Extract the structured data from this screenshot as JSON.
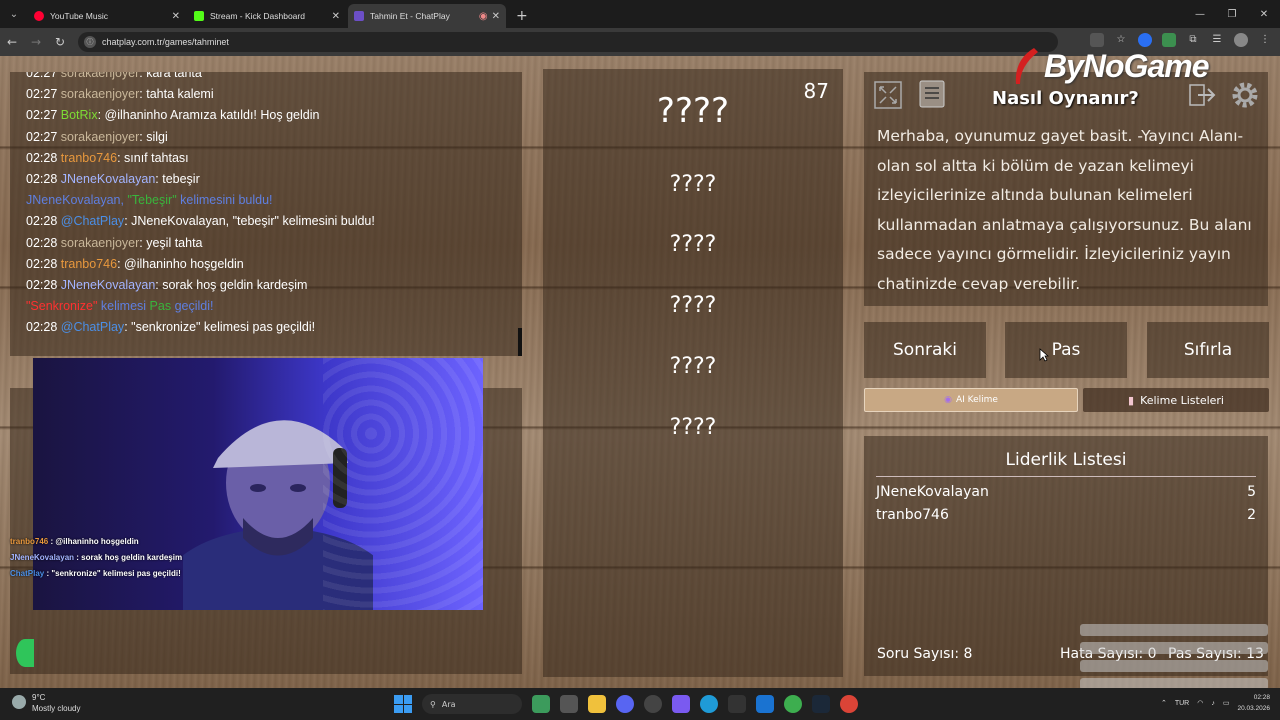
{
  "browser": {
    "tabs": [
      {
        "title": "YouTube Music",
        "color": "#ff0033"
      },
      {
        "title": "Stream - Kick Dashboard",
        "color": "#53fc18"
      },
      {
        "title": "Tahmin Et - ChatPlay",
        "color": "#6c4fc7"
      }
    ],
    "url": "chatplay.com.tr/games/tahminet"
  },
  "chat": {
    "messages": [
      {
        "time": "02:27",
        "user": "sorakaenjoyer",
        "text": ": kara tahta"
      },
      {
        "time": "02:27",
        "user": "sorakaenjoyer",
        "text": ": tahta kalemi"
      },
      {
        "time": "02:27",
        "user": "BotRix",
        "text": ": @ilhaninho Aramıza katıldı! Hoş geldin"
      },
      {
        "time": "02:27",
        "user": "sorakaenjoyer",
        "text": ": silgi"
      },
      {
        "time": "02:28",
        "user": "tranbo746",
        "text": ": sınıf tahtası"
      },
      {
        "time": "02:28",
        "user": "JNeneKovalayan",
        "text": ": tebeşir"
      },
      {
        "system1_user": "JNeneKovalayan,",
        "system1_word": "\"Tebeşir\"",
        "system1_text": "kelimesini buldu!"
      },
      {
        "time": "02:28",
        "user": "@ChatPlay",
        "text": ": JNeneKovalayan, \"tebeşir\" kelimesini buldu!"
      },
      {
        "time": "02:28",
        "user": "sorakaenjoyer",
        "text": ": yeşil tahta"
      },
      {
        "time": "02:28",
        "user": "tranbo746",
        "text": ": @ilhaninho hoşgeldin"
      },
      {
        "time": "02:28",
        "user": "JNeneKovalayan",
        "text": ": sorak hoş geldin kardeşim"
      },
      {
        "system2_word": "\"Senkronize\"",
        "system2_kel": "kelimesi",
        "system2_pas": "Pas",
        "system2_text": "geçildi!"
      },
      {
        "time": "02:28",
        "user": "@ChatPlay",
        "text": ": \"senkronize\" kelimesi pas geçildi!"
      }
    ]
  },
  "cam_chat": [
    {
      "user": "tranbo746",
      "text": " : @ilhaninho hoşgeldin"
    },
    {
      "user": "JNeneKovalayan",
      "text": " : sorak hoş geldin kardeşim"
    },
    {
      "user": "ChatPlay",
      "text": " : \"senkronize\" kelimesi pas geçildi!"
    }
  ],
  "game": {
    "counter": "87",
    "main_word": "????",
    "hidden_words": [
      "????",
      "????",
      "????",
      "????",
      "????"
    ]
  },
  "right": {
    "brand": "ByNoGame",
    "howto": "Nasıl Oynanır?",
    "description": "Merhaba, oyunumuz gayet basit. -Yayıncı Alanı- olan sol altta ki bölüm de yazan kelimeyi izleyicilerinize altında bulunan kelimeleri kullanmadan anlatmaya çalışıyorsunuz. Bu alanı sadece yayıncı görmelidir. İzleyicileriniz yayın chatinizde cevap verebilir.",
    "buttons": {
      "next": "Sonraki",
      "pass": "Pas",
      "reset": "Sıfırla"
    },
    "ai_word": "AI Kelime",
    "word_lists": "Kelime Listeleri"
  },
  "leaderboard": {
    "title": "Liderlik Listesi",
    "rows": [
      {
        "name": "JNeneKovalayan",
        "score": "5"
      },
      {
        "name": "tranbo746",
        "score": "2"
      }
    ]
  },
  "stats": {
    "questions": "Soru Sayısı: 8",
    "errors": "Hata Sayısı: 0",
    "passes": "Pas Sayısı: 13"
  },
  "taskbar": {
    "weather_temp": "9°C",
    "weather_desc": "Mostly cloudy",
    "search": "Ara",
    "lang": "TUR",
    "time": "02:28",
    "date": "20.03.2026"
  }
}
